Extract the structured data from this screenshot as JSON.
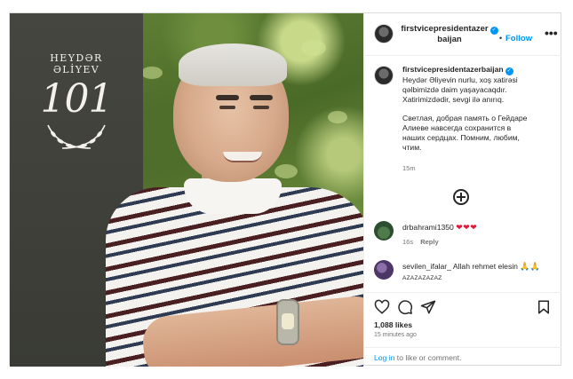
{
  "media": {
    "brand_name": "HEYDƏR ƏLİYEV",
    "brand_number": "101"
  },
  "header": {
    "username_line1": "firstvicepresidentazer",
    "username_line2": "baijan",
    "separator": "•",
    "follow_label": "Follow",
    "more_label": "•••"
  },
  "caption": {
    "username": "firstvicepresidentazerbaijan",
    "lines_az": [
      "Heydər Əliyevin nurlu, xoş xatirəsi",
      "qəlbimizdə daim yaşayacaqdır.",
      "Xatirimizdədir, sevgi ilə anırıq."
    ],
    "lines_ru": [
      "Светлая, добрая память о Гейдаре",
      "Алиеве навсегда сохранится в",
      "наших сердцах. Помним, любим,",
      "чтим."
    ],
    "time": "15m"
  },
  "comments": [
    {
      "username": "drbahrami1350",
      "text": "",
      "emoji": "❤❤❤",
      "time": "16s",
      "reply_label": "Reply"
    },
    {
      "username": "sevilen_ifalar_",
      "text": "Allah rehmet elesin",
      "emoji": "🙏🙏",
      "subtext": "AZAZAZAZAZ"
    }
  ],
  "engagement": {
    "likes": "1,088 likes",
    "posted": "15 minutes ago"
  },
  "login": {
    "link": "Log in",
    "rest": " to like or comment."
  },
  "colors": {
    "accent": "#0095f6",
    "heart": "#e0193a",
    "text": "#262626",
    "muted": "#737373"
  },
  "icons": [
    "more-options-icon",
    "add-comment-icon",
    "like-heart-icon",
    "comment-bubble-icon",
    "share-send-icon",
    "save-bookmark-icon",
    "verified-badge-icon"
  ]
}
